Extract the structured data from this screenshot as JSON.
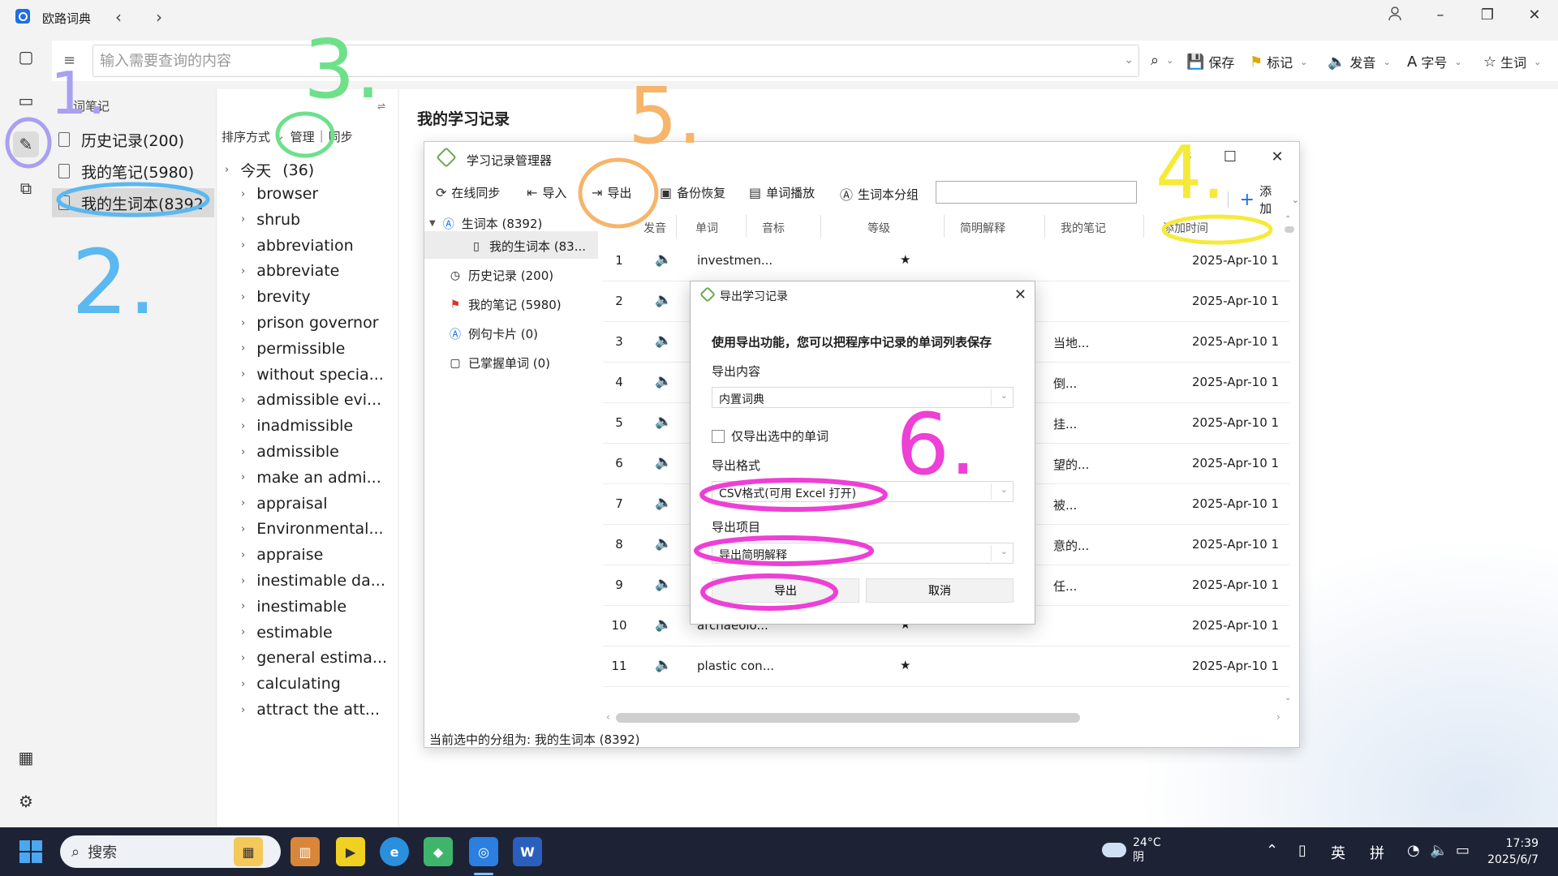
{
  "titlebar": {
    "app_title": "欧路词典",
    "back_icon": "‹",
    "forward_icon": "›"
  },
  "search": {
    "placeholder": "输入需要查询的内容",
    "toolbar": {
      "save": "保存",
      "mark": "标记",
      "speak": "发音",
      "font": "字号",
      "vocab": "生词"
    }
  },
  "left": {
    "header": "词笔记",
    "items": [
      {
        "label": "历史记录(200)"
      },
      {
        "label": "我的笔记(5980)"
      },
      {
        "label": "我的生词本(8392)"
      }
    ]
  },
  "middle": {
    "sort_label": "排序方式",
    "manage": "管理",
    "sync": "同步",
    "today": "今天",
    "today_count": "(36)",
    "words": [
      "browser",
      "shrub",
      "abbreviation",
      "abbreviate",
      "brevity",
      "prison governor",
      "permissible",
      "without specia...",
      "admissible evi...",
      "inadmissible",
      "admissible",
      "make an admi...",
      "appraisal",
      "Environmental...",
      "appraise",
      "inestimable da...",
      "inestimable",
      "estimable",
      "general estima...",
      "calculating",
      "attract the att..."
    ]
  },
  "main": {
    "title": "我的学习记录"
  },
  "manager": {
    "title": "学习记录管理器",
    "toolbar": {
      "sync": "在线同步",
      "import": "导入",
      "export": "导出",
      "backup": "备份恢复",
      "play": "单词播放",
      "group": "生词本分组",
      "add": "添加"
    },
    "tree": [
      {
        "label": "生词本 (8392)"
      },
      {
        "label": "我的生词本 (83..."
      },
      {
        "label": "历史记录 (200)"
      },
      {
        "label": "我的笔记 (5980)"
      },
      {
        "label": "例句卡片 (0)"
      },
      {
        "label": "已掌握单词 (0)"
      }
    ],
    "columns": [
      "发音",
      "单词",
      "音标",
      "等级",
      "简明解释",
      "我的笔记",
      "添加时间"
    ],
    "rows": [
      {
        "num": "1",
        "word": "investmen...",
        "star": "★",
        "expl": "",
        "date": "2025-Apr-10 1"
      },
      {
        "num": "2",
        "word": "",
        "star": "",
        "expl": "",
        "date": "2025-Apr-10 1"
      },
      {
        "num": "3",
        "word": "",
        "star": "",
        "expl": "当地...",
        "date": "2025-Apr-10 1"
      },
      {
        "num": "4",
        "word": "",
        "star": "",
        "expl": "倒...",
        "date": "2025-Apr-10 1"
      },
      {
        "num": "5",
        "word": "",
        "star": "",
        "expl": "挂...",
        "date": "2025-Apr-10 1"
      },
      {
        "num": "6",
        "word": "",
        "star": "",
        "expl": "望的...",
        "date": "2025-Apr-10 1"
      },
      {
        "num": "7",
        "word": "",
        "star": "",
        "expl": "被...",
        "date": "2025-Apr-10 1"
      },
      {
        "num": "8",
        "word": "",
        "star": "",
        "expl": "意的...",
        "date": "2025-Apr-10 1"
      },
      {
        "num": "9",
        "word": "",
        "star": "",
        "expl": "任...",
        "date": "2025-Apr-10 1"
      },
      {
        "num": "10",
        "word": "archaeolo...",
        "star": "★",
        "expl": "",
        "date": "2025-Apr-10 1"
      },
      {
        "num": "11",
        "word": "plastic con...",
        "star": "★",
        "expl": "",
        "date": "2025-Apr-10 1"
      }
    ],
    "status": "当前选中的分组为: 我的生词本 (8392)"
  },
  "dialog": {
    "title": "导出学习记录",
    "description": "使用导出功能，您可以把程序中记录的单词列表保存",
    "content_label": "导出内容",
    "content_value": "内置词典",
    "only_selected": "仅导出选中的单词",
    "format_label": "导出格式",
    "format_value": "CSV格式(可用 Excel 打开)",
    "items_label": "导出项目",
    "items_value": "导出简明解释",
    "export_btn": "导出",
    "cancel_btn": "取消"
  },
  "annotations": {
    "n1": "1.",
    "n2": "2.",
    "n3": "3.",
    "n4": "4.",
    "n5": "5.",
    "n6": "6."
  },
  "taskbar": {
    "search": "搜索",
    "weather_temp": "24°C",
    "weather_desc": "阴",
    "ime_lang": "英",
    "ime_mode": "拼",
    "time": "17:39",
    "date": "2025/6/7"
  },
  "colors": {
    "accent": "#1e6fe0",
    "annotation_purple": "#a8a0f0",
    "annotation_blue": "#5bb8f0",
    "annotation_green": "#6ee08a",
    "annotation_orange": "#f6b56b",
    "annotation_yellow": "#f5ea3a",
    "annotation_pink": "#ee3fd6"
  }
}
